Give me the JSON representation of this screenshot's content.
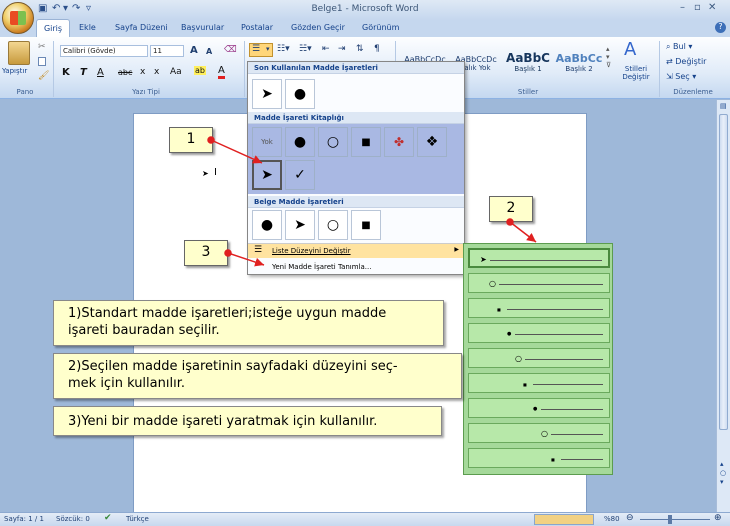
{
  "window": {
    "title": "Belge1 - Microsoft Word",
    "min": "–",
    "max": "▫",
    "close": "✕"
  },
  "qat": {
    "save": "▣",
    "undo": "↶",
    "undo_dd": "▾",
    "redo": "↷",
    "more": "▿"
  },
  "tabs": [
    "Giriş",
    "Ekle",
    "Sayfa Düzeni",
    "Başvurular",
    "Postalar",
    "Gözden Geçir",
    "Görünüm"
  ],
  "help": "?",
  "ribbon": {
    "clipboard": {
      "paste": "Yapıştır",
      "label": "Pano"
    },
    "font": {
      "name": "Calibri (Gövde)",
      "size": "11",
      "grow": "A",
      "shrink": "A",
      "clear": "⌫",
      "bold": "K",
      "italic": "T",
      "underline": "A",
      "strike": "abc",
      "sub": "x",
      "sup": "x",
      "case": "Aa",
      "highlight": "ab",
      "color": "A",
      "label": "Yazı Tipi"
    },
    "styles": {
      "items": [
        "AaBbCcDc",
        "AaBbCcDc",
        "AaBbC",
        "AaBbCc"
      ],
      "names": [
        "",
        "ralık Yok",
        "Başlık 1",
        "Başlık 2"
      ],
      "change": "Stilleri Değiştir",
      "label": "Stiller"
    },
    "editing": {
      "find": "Bul",
      "replace": "Değiştir",
      "select": "Seç",
      "label": "Düzenleme"
    }
  },
  "dropdown": {
    "recent_title": "Son Kullanılan Madde İşaretleri",
    "library_title": "Madde İşareti Kitaplığı",
    "none": "Yok",
    "doc_title": "Belge Madde İşaretleri",
    "change_level": "Liste Düzeyini Değiştir",
    "define_new": "Yeni Madde İşareti Tanımla..."
  },
  "document": {
    "bullet": "➤",
    "cursor": "I"
  },
  "annotations": {
    "n1": "1",
    "n2": "2",
    "n3": "3",
    "text1_line1": "1)Standart madde işaretleri;isteğe uygun madde",
    "text1_line2": "işareti bauradan seçilir.",
    "text2_line1": "2)Seçilen madde işaretinin sayfadaki düzeyini seç-",
    "text2_line2": "mek için kullanılır.",
    "text3": "3)Yeni bir madde işareti yaratmak için kullanılır."
  },
  "levels": [
    "➤",
    "○",
    "■",
    "●",
    "○",
    "■",
    "●",
    "○",
    "■"
  ],
  "status": {
    "page": "Sayfa: 1 / 1",
    "words": "Sözcük: 0",
    "lang": "Türkçe",
    "zoom": "%80"
  },
  "colors": {
    "ribbon_text": "#15428b",
    "annotation_bg": "#ffffcc",
    "level_bg": "#a5d99a",
    "arrow": "#e02020"
  }
}
